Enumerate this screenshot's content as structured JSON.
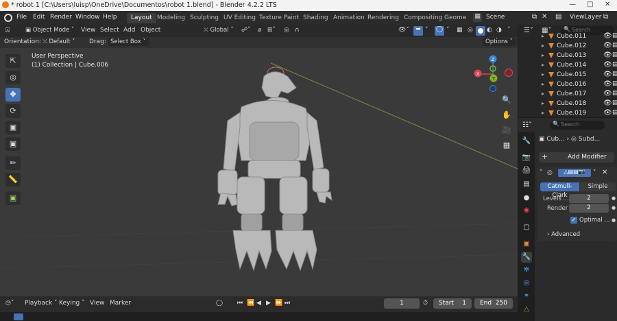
{
  "window": {
    "title": "* robot 1 [C:\\Users\\luisp\\OneDrive\\Documentos\\robot 1.blend] - Blender 4.2.2 LTS"
  },
  "menubar": {
    "items": [
      "File",
      "Edit",
      "Render",
      "Window",
      "Help"
    ],
    "workspaces": [
      "Layout",
      "Modeling",
      "Sculpting",
      "UV Editing",
      "Texture Paint",
      "Shading",
      "Animation",
      "Rendering",
      "Compositing",
      "Geome"
    ],
    "scene": "Scene",
    "view_layer": "ViewLayer"
  },
  "viewport_header": {
    "mode": "Object Mode",
    "menus": [
      "View",
      "Select",
      "Add",
      "Object"
    ],
    "transform_orientation": "Global"
  },
  "tool_settings": {
    "orientation_label": "Orientation:",
    "orientation_value": "Default",
    "drag_label": "Drag:",
    "drag_value": "Select Box",
    "options_label": "Options"
  },
  "viewport_overlay": {
    "perspective": "User Perspective",
    "collection_info": "(1) Collection | Cube.006"
  },
  "gizmo": {
    "x": "X",
    "y": "Y",
    "z": "Z"
  },
  "timeline": {
    "menus": [
      "Playback",
      "Keying",
      "View",
      "Marker"
    ],
    "current_frame": "1",
    "start_label": "Start",
    "start_value": "1",
    "end_label": "End",
    "end_value": "250"
  },
  "outliner": {
    "search_placeholder": "Search",
    "items": [
      "Cube.011",
      "Cube.012",
      "Cube.013",
      "Cube.014",
      "Cube.015",
      "Cube.016",
      "Cube.017",
      "Cube.018",
      "Cube.019"
    ]
  },
  "properties": {
    "search_placeholder": "Search",
    "breadcrumb_object": "Cub...",
    "breadcrumb_modifier": "Subd...",
    "add_modifier_label": "Add Modifier",
    "subdivision_types": [
      "Catmull-Clark",
      "Simple"
    ],
    "fields": [
      {
        "label": "Levels ...",
        "value": "2"
      },
      {
        "label": "Render",
        "value": "2"
      }
    ],
    "optimal_label": "Optimal ...",
    "advanced_label": "Advanced"
  },
  "colors": {
    "active_blue": "#4772b3",
    "viewport_bg": "#3a3a3a",
    "mesh_orange": "#e08a3a",
    "gizmo_x": "#e0434f",
    "gizmo_y": "#7fb51e",
    "gizmo_z": "#3b85d6"
  }
}
